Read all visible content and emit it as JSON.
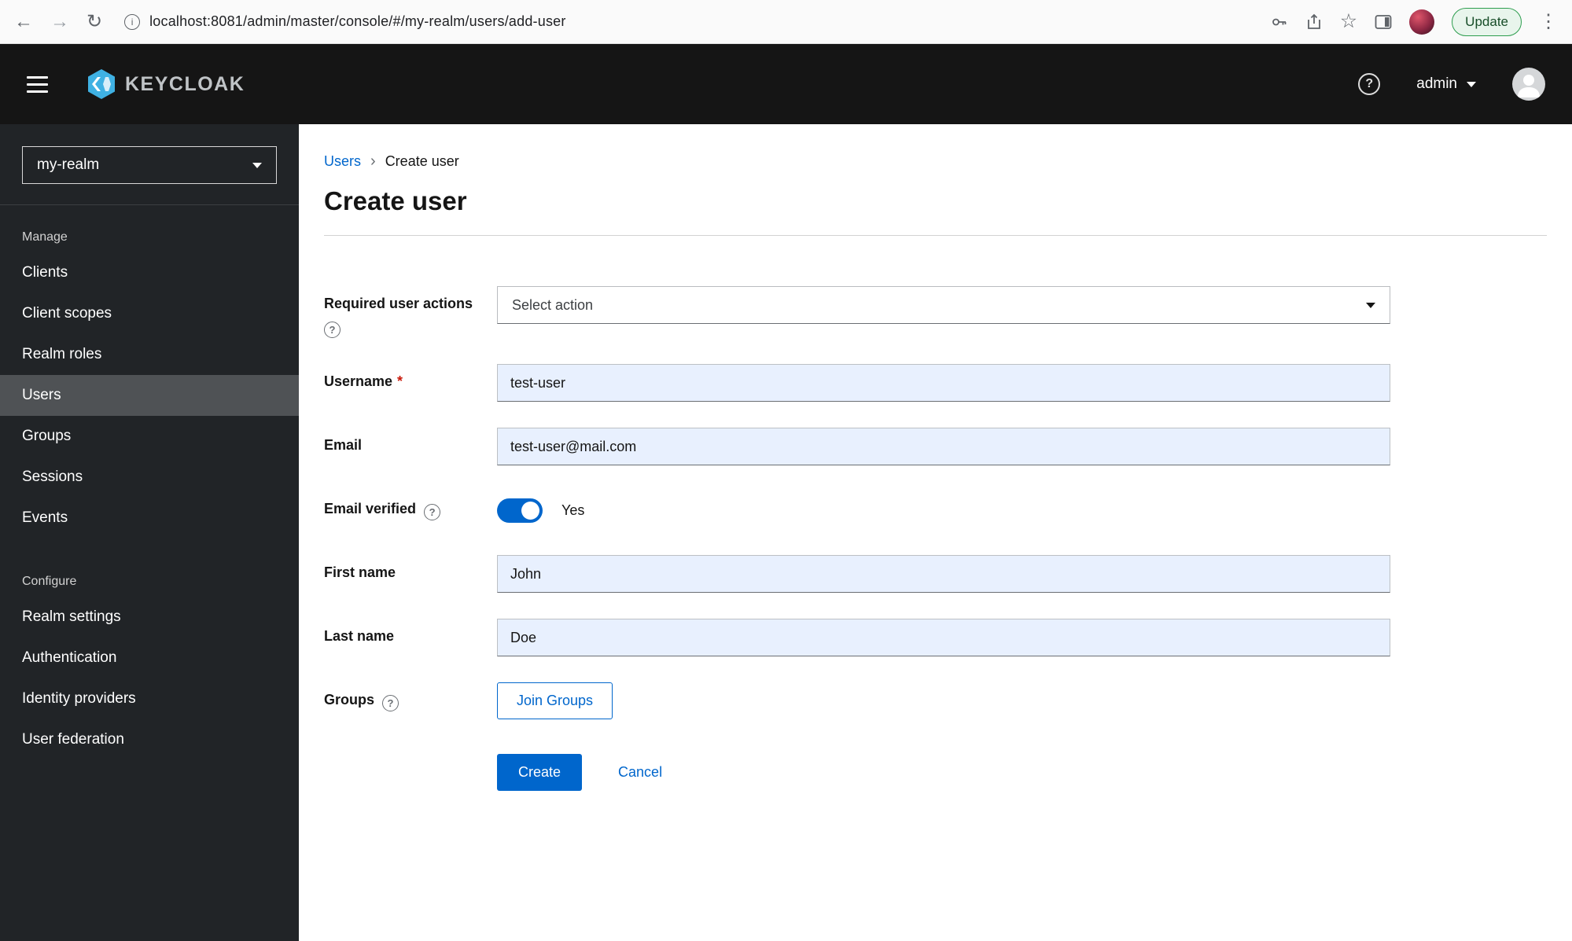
{
  "browser": {
    "back_icon": "←",
    "forward_icon": "→",
    "reload_icon": "↻",
    "info_icon": "i",
    "url": "localhost:8081/admin/master/console/#/my-realm/users/add-user",
    "star_icon": "☆",
    "update_label": "Update",
    "more_icon": "⋮"
  },
  "header": {
    "brand": "KEYCLOAK",
    "help_icon": "?",
    "username": "admin"
  },
  "sidebar": {
    "realm": "my-realm",
    "groups": [
      {
        "label": "Manage",
        "items": [
          {
            "label": "Clients"
          },
          {
            "label": "Client scopes"
          },
          {
            "label": "Realm roles"
          },
          {
            "label": "Users"
          },
          {
            "label": "Groups"
          },
          {
            "label": "Sessions"
          },
          {
            "label": "Events"
          }
        ]
      },
      {
        "label": "Configure",
        "items": [
          {
            "label": "Realm settings"
          },
          {
            "label": "Authentication"
          },
          {
            "label": "Identity providers"
          },
          {
            "label": "User federation"
          }
        ]
      }
    ]
  },
  "main": {
    "breadcrumb": {
      "parent": "Users",
      "separator": "›",
      "current": "Create user"
    },
    "title": "Create user",
    "form": {
      "required_user_actions": {
        "label": "Required user actions",
        "placeholder": "Select action",
        "help_icon": "?"
      },
      "username": {
        "label": "Username",
        "required_marker": "*",
        "value": "test-user"
      },
      "email": {
        "label": "Email",
        "value": "test-user@mail.com"
      },
      "email_verified": {
        "label": "Email verified",
        "help_icon": "?",
        "state": "Yes"
      },
      "first_name": {
        "label": "First name",
        "value": "John"
      },
      "last_name": {
        "label": "Last name",
        "value": "Doe"
      },
      "groups": {
        "label": "Groups",
        "help_icon": "?",
        "button_label": "Join Groups"
      },
      "create_label": "Create",
      "cancel_label": "Cancel"
    }
  }
}
